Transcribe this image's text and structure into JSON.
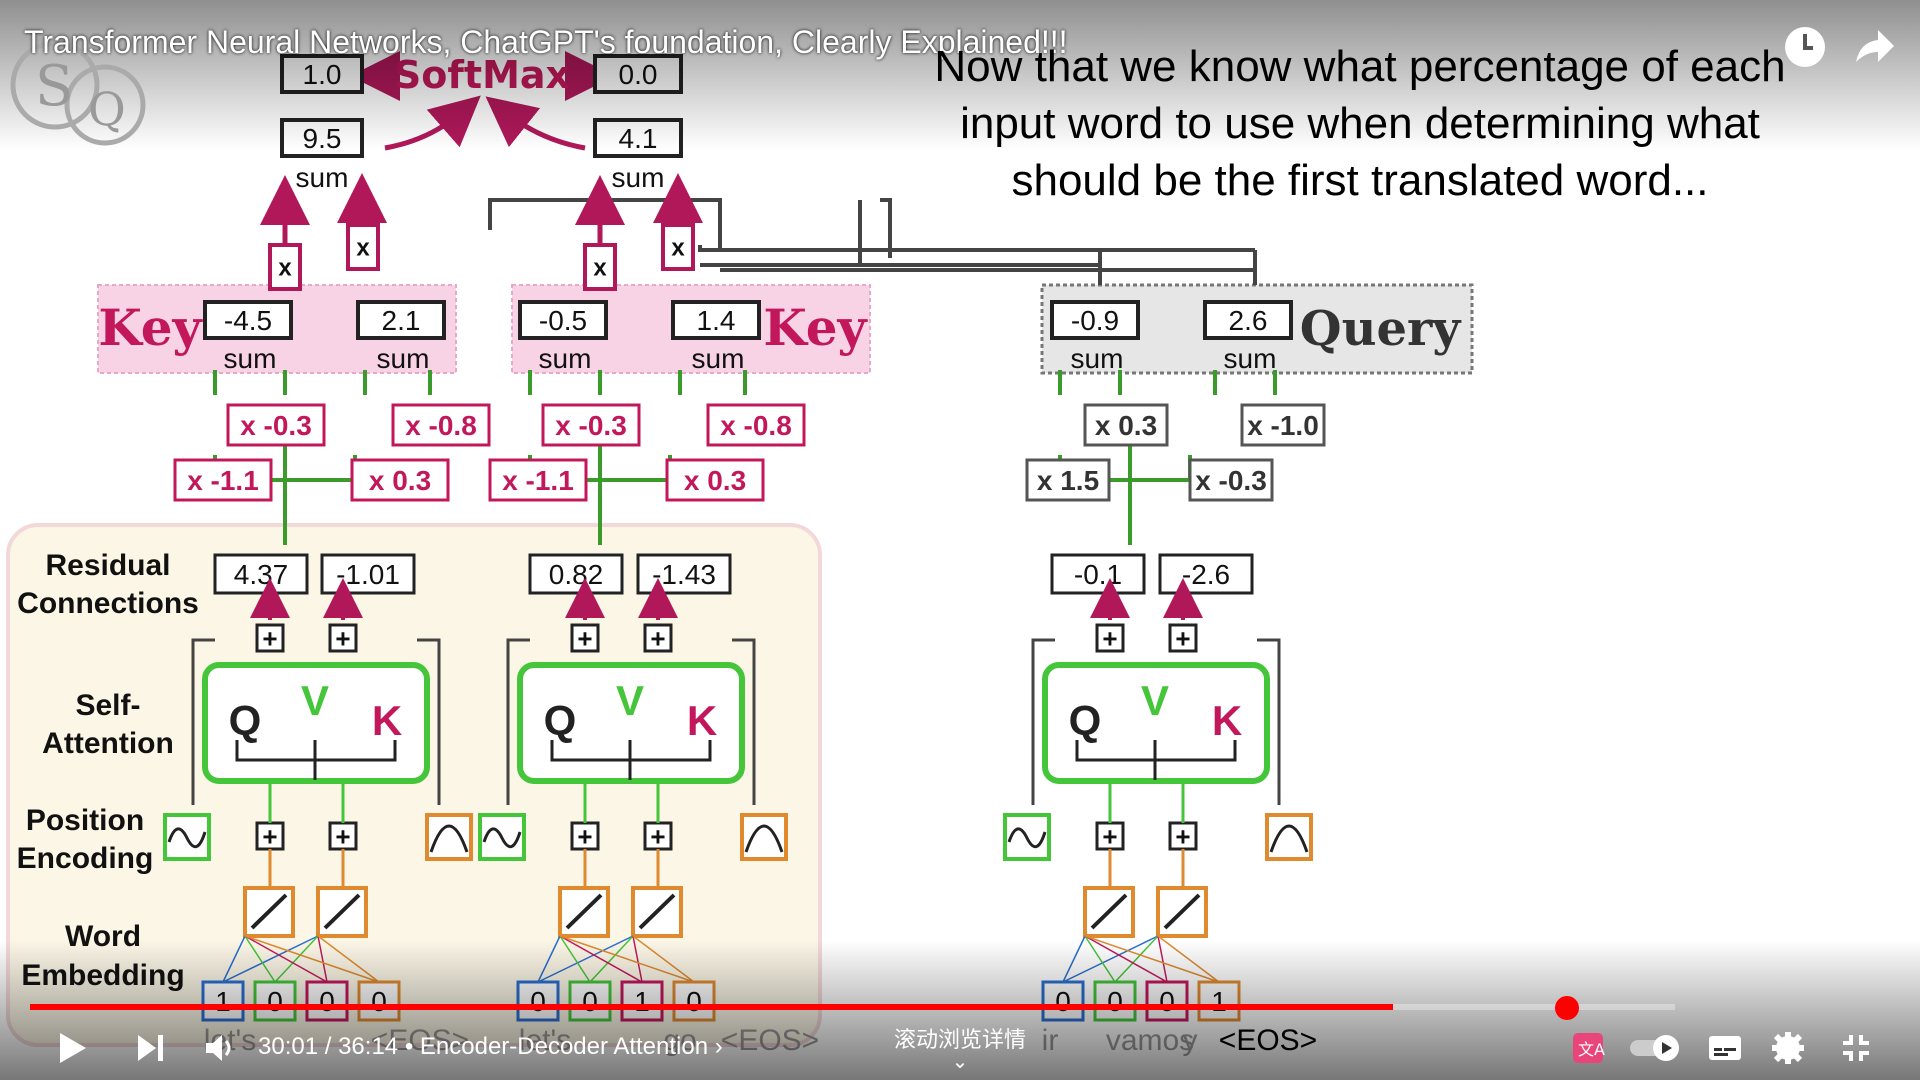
{
  "video": {
    "title": "Transformer Neural Networks, ChatGPT's foundation, Clearly Explained!!!",
    "caption_lines": [
      "Now that we know what percentage of each",
      "input word to use when determining what",
      "should be the first translated word..."
    ]
  },
  "diagram": {
    "softmax_label": "SoftMax",
    "softmax_outputs": [
      "1.0",
      "0.0"
    ],
    "sums": [
      "9.5",
      "4.1"
    ],
    "sum_label": "sum",
    "times_label": "x",
    "key_label": "Key",
    "query_label": "Query",
    "keys": [
      "-4.5",
      "2.1",
      "-0.5",
      "1.4"
    ],
    "query": [
      "-0.9",
      "2.6"
    ],
    "key_weights": [
      "x -0.3",
      "x -0.8",
      "x -1.1",
      "x 0.3",
      "x -0.3",
      "x -0.8",
      "x -1.1",
      "x 0.3"
    ],
    "query_weights": [
      "x 0.3",
      "x -1.0",
      "x 1.5",
      "x -0.3"
    ],
    "residual": [
      "4.37",
      "-1.01",
      "0.82",
      "-1.43",
      "-0.1",
      "-2.6"
    ],
    "row_labels": {
      "residual": [
        "Residual",
        "Connections"
      ],
      "self_attention": [
        "Self-",
        "Attention"
      ],
      "position": [
        "Position",
        "Encoding"
      ],
      "word": [
        "Word",
        "Embedding"
      ]
    },
    "qvk": [
      "Q",
      "V",
      "K"
    ],
    "one_hot": [
      [
        "1",
        "0",
        "0",
        "0"
      ],
      [
        "0",
        "0",
        "1",
        "0"
      ],
      [
        "0",
        "0",
        "0",
        "1"
      ]
    ],
    "tokens": [
      "let's",
      "<EOS>",
      "let's",
      "go",
      "<EOS>",
      "ir",
      "vamos",
      "y",
      "<EOS>"
    ]
  },
  "player": {
    "current_time": "30:01",
    "duration": "36:14",
    "chapter": "Encoder-Decoder Attention",
    "scroll_hint": "滚动浏览详情",
    "progress_fraction": 0.8285,
    "colors": {
      "progress": "#ff0000",
      "key_bg": "#f8d3e6",
      "query_bg": "#e6e6e6",
      "attention_green": "#44c53a",
      "magenta": "#c2185b"
    }
  }
}
